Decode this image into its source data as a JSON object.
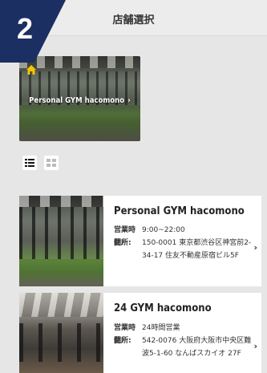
{
  "step": {
    "number": "2",
    "color": "#1c2f63"
  },
  "header": {
    "title": "店舗選択"
  },
  "featured": {
    "label": "Personal GYM hacomono",
    "chevron": "›",
    "icon": "home-icon"
  },
  "view_toggles": [
    {
      "icon": "list-view-icon",
      "active": true
    },
    {
      "icon": "grid-view-icon",
      "active": false
    }
  ],
  "stores": [
    {
      "name": "Personal GYM hacomono",
      "hours_label": "営業時間:",
      "hours": "9:00~22:00",
      "address_label": "住所:",
      "address": "150-0001 東京都渋谷区神宮前2-34-17 住友不動産原宿ビル5F",
      "chevron": "›"
    },
    {
      "name": "24 GYM hacomono",
      "hours_label": "営業時間:",
      "hours": "24時間営業",
      "address_label": "住所:",
      "address": "542-0076 大阪府大阪市中央区難波5-1-60 なんばスカイオ 27F",
      "chevron": "›"
    }
  ]
}
